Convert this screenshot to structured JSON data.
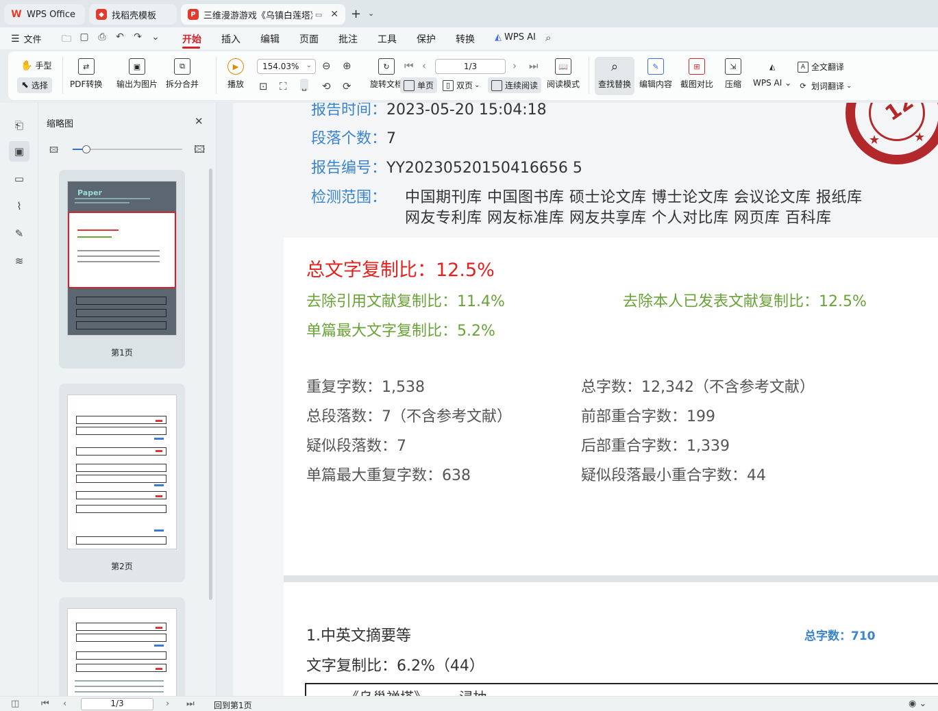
{
  "tabs": {
    "home": "WPS Office",
    "template": "找稻壳模板",
    "doc": "三维漫游游戏《乌镇白莲塔》的"
  },
  "menubar": {
    "file": "文件",
    "items": [
      "开始",
      "插入",
      "编辑",
      "页面",
      "批注",
      "工具",
      "保护",
      "转换"
    ],
    "wps_ai": "WPS AI"
  },
  "ribbon": {
    "hand": "手型",
    "select": "选择",
    "pdf_convert": "PDF转换",
    "export_image": "输出为图片",
    "split_merge": "拆分合并",
    "play": "播放",
    "zoom": "154.03%",
    "page_indicator": "1/3",
    "rotate": "旋转文档",
    "single": "单页",
    "double": "双页",
    "continuous": "连续阅读",
    "read_mode": "阅读模式",
    "find_replace": "查找替换",
    "edit_content": "编辑内容",
    "screenshot_compare": "截图对比",
    "compress": "压缩",
    "wps_ai": "WPS AI",
    "full_translate": "全文翻译",
    "word_translate": "划词翻译"
  },
  "thumbnails": {
    "title": "缩略图",
    "pages": [
      "第1页",
      "第2页"
    ]
  },
  "document": {
    "report_time_label": "报告时间：",
    "report_time": "2023-05-20 15:04:18",
    "para_count_label": "段落个数：",
    "para_count": "7",
    "report_no_label": "报告编号：",
    "report_no": "YY20230520150416656 5",
    "scope_label": "检测范围：",
    "scope_line1": "中国期刊库  中国图书库  硕士论文库  博士论文库  会议论文库  报纸库",
    "scope_line2": "网友专利库  网友标准库  网友共享库  个人对比库  网页库  百科库",
    "total_ratio": "总文字复制比：12.5%",
    "exclude_ref": "去除引用文献复制比：11.4%",
    "exclude_self": "去除本人已发表文献复制比：12.5%",
    "single_max": "单篇最大文字复制比：5.2%",
    "repeat_chars": "重复字数：1,538",
    "total_chars": "总字数：12,342（不含参考文献）",
    "total_paras": "总段落数：7（不含参考文献）",
    "front_overlap": "前部重合字数：199",
    "suspect_paras": "疑似段落数：7",
    "back_overlap": "后部重合字数：1,339",
    "single_max_repeat": "单篇最大重复字数：638",
    "min_suspect_overlap": "疑似段落最小重合字数：44",
    "section_title": "1.中英文摘要等",
    "section_total": "总字数：710",
    "section_ratio": "文字复制比：6.2%（44）",
    "box_text": "《乌巢禅塔》…… 浸抽",
    "stamp_text": "12"
  },
  "statusbar": {
    "page": "1/3",
    "back_to_first": "回到第1页"
  }
}
